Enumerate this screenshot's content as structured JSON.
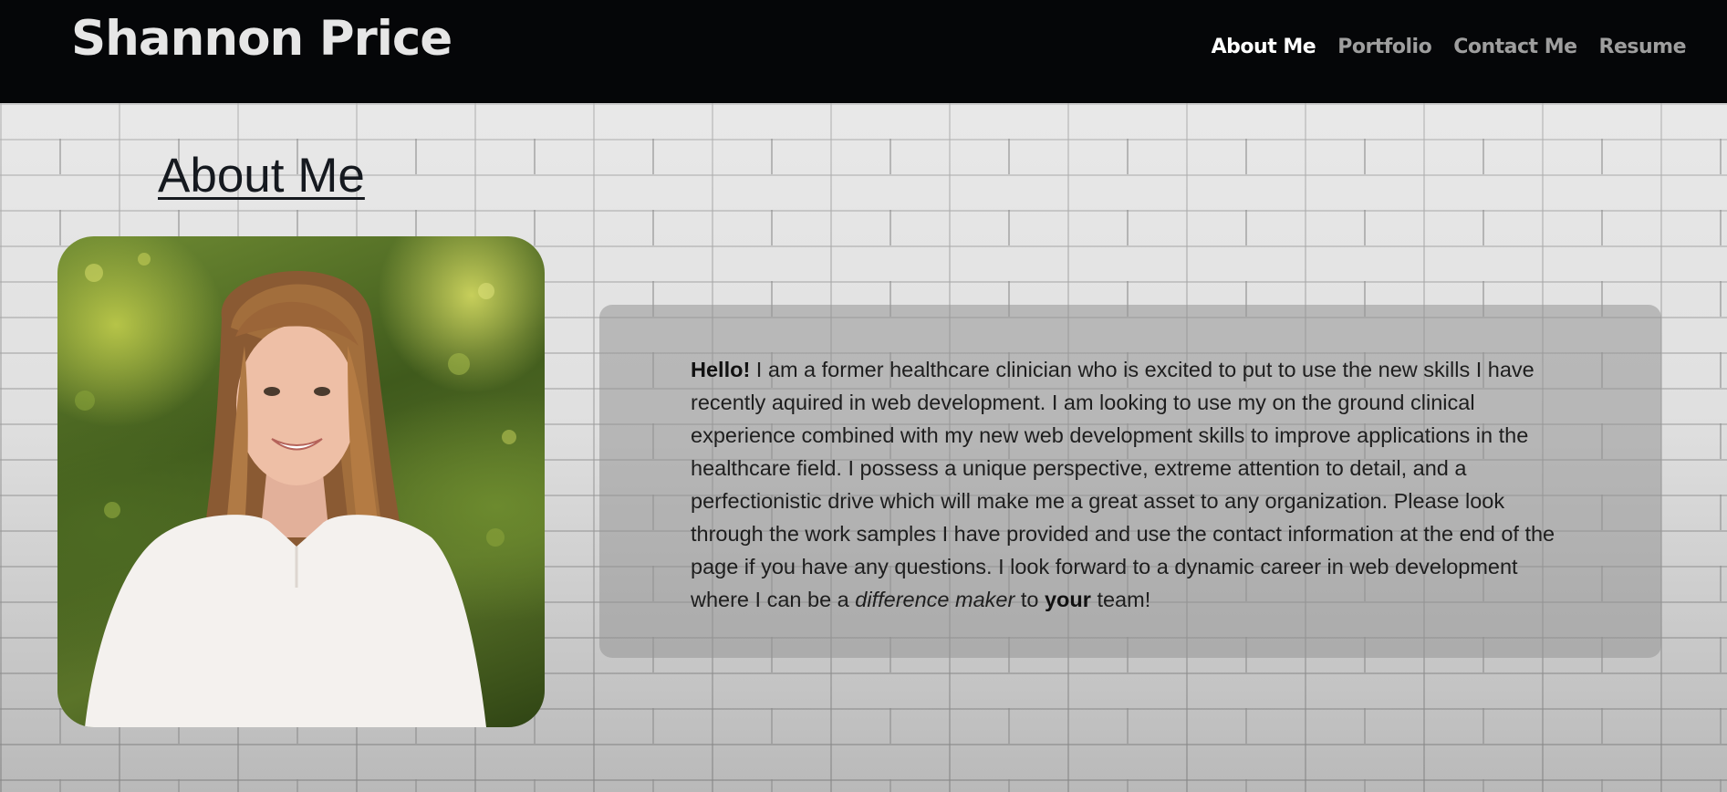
{
  "header": {
    "brand": "Shannon Price",
    "nav": [
      {
        "label": "About Me",
        "active": true
      },
      {
        "label": "Portfolio",
        "active": false
      },
      {
        "label": "Contact Me",
        "active": false
      },
      {
        "label": "Resume",
        "active": false
      }
    ]
  },
  "about": {
    "title": "About Me",
    "bio": {
      "greeting": "Hello!",
      "body": " I am a former healthcare clinician who is excited to put to use the new skills I have recently aquired in web development. I am looking to use my on the ground clinical experience combined with my new web development skills to improve applications in the healthcare field. I possess a unique perspective, extreme attention to detail, and a perfectionistic drive which will make me a great asset to any organization. Please look through the work samples I have provided and use the contact information at the end of the page if you have any questions. I look forward to a dynamic career in web development where I can be a ",
      "emphasis": "difference maker",
      "connector": " to ",
      "strong": "your",
      "ending": " team!"
    }
  },
  "colors": {
    "header_bg": "#050608",
    "nav_active": "#ffffff",
    "nav_inactive": "#9e9e9e",
    "title": "#15191f",
    "bio_box": "#969696"
  }
}
